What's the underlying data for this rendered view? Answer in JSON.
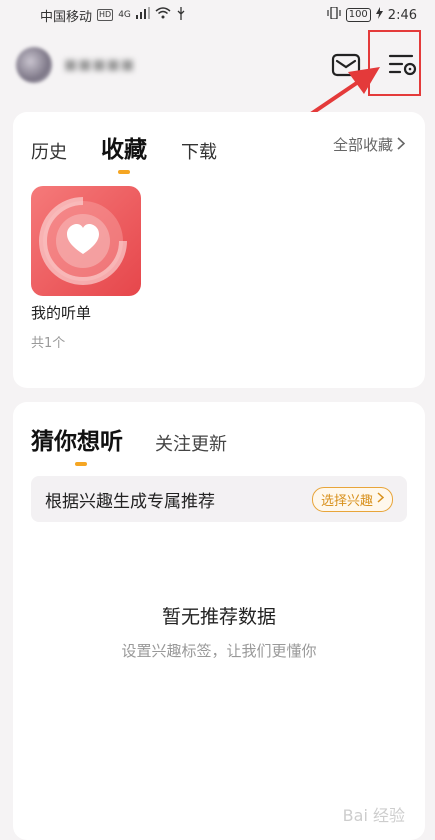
{
  "status_bar": {
    "carrier": "中国移动",
    "hd_badge": "HD",
    "network": "4G",
    "battery": "100",
    "time": "2:46"
  },
  "header": {
    "username": "■■■■■"
  },
  "favorites": {
    "tabs": [
      {
        "label": "历史"
      },
      {
        "label": "收藏"
      },
      {
        "label": "下载"
      }
    ],
    "all_label": "全部收藏",
    "playlist": {
      "title": "我的听单",
      "count": "共1个"
    }
  },
  "recommend": {
    "tabs": [
      {
        "label": "猜你想听"
      },
      {
        "label": "关注更新"
      }
    ],
    "interest_text": "根据兴趣生成专属推荐",
    "interest_button": "选择兴趣",
    "empty_title": "暂无推荐数据",
    "empty_subtitle": "设置兴趣标签，让我们更懂你"
  },
  "watermark": "Bai 经验",
  "colors": {
    "accent": "#f5a623",
    "highlight": "#e43a3a",
    "cover": "#e6464b"
  }
}
